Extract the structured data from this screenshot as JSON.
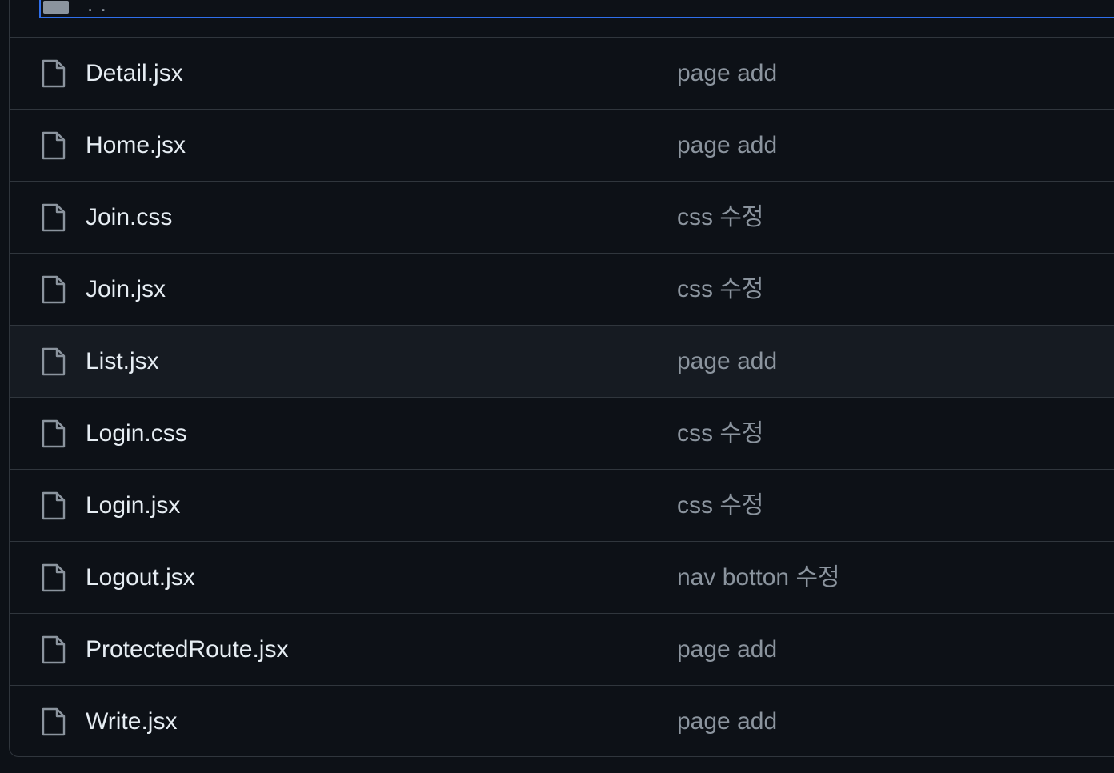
{
  "parent_dir": {
    "label": ". ."
  },
  "files": [
    {
      "name": "Detail.jsx",
      "message": "page add",
      "icon": "file-icon"
    },
    {
      "name": "Home.jsx",
      "message": "page add",
      "icon": "file-icon"
    },
    {
      "name": "Join.css",
      "message": "css 수정",
      "icon": "file-icon"
    },
    {
      "name": "Join.jsx",
      "message": "css 수정",
      "icon": "file-icon"
    },
    {
      "name": "List.jsx",
      "message": "page add",
      "icon": "file-icon"
    },
    {
      "name": "Login.css",
      "message": "css 수정",
      "icon": "file-icon"
    },
    {
      "name": "Login.jsx",
      "message": "css 수정",
      "icon": "file-icon"
    },
    {
      "name": "Logout.jsx",
      "message": "nav botton 수정",
      "icon": "file-icon"
    },
    {
      "name": "ProtectedRoute.jsx",
      "message": "page add",
      "icon": "file-icon"
    },
    {
      "name": "Write.jsx",
      "message": "page add",
      "icon": "file-icon"
    }
  ],
  "colors": {
    "background": "#0d1117",
    "border": "#30363d",
    "focus_outline": "#2f6feb",
    "text_primary": "#e6edf3",
    "text_muted": "#8b949e",
    "hover_row": "#161b22"
  }
}
